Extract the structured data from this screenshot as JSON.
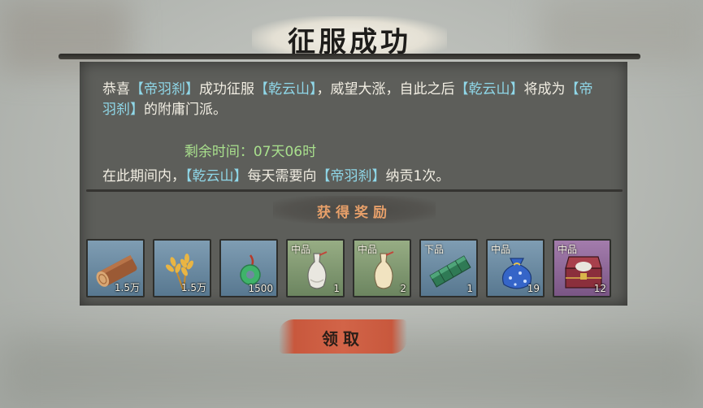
{
  "banner": {
    "title": "征服成功"
  },
  "message": {
    "t1": "恭喜",
    "sect_a": "【帝羽刹】",
    "t2": "成功征服",
    "sect_b": "【乾云山】",
    "t3": "，威望大涨，自此之后",
    "sect_b2": "【乾云山】",
    "t4": "将成为",
    "sect_a2": "【帝羽刹】",
    "t5": "的附庸门派。"
  },
  "remaining": {
    "label": "剩余时间：",
    "value": "07天06时"
  },
  "tribute": {
    "t1": "在此期间内，",
    "sect_b": "【乾云山】",
    "t2": "每天需要向",
    "sect_a": "【帝羽刹】",
    "t3": "纳贡1次。"
  },
  "rewards": {
    "header": "获得奖励",
    "items": [
      {
        "icon": "wood-log-icon",
        "grade": "",
        "qty": "1.5万",
        "color": "blue"
      },
      {
        "icon": "wheat-icon",
        "grade": "",
        "qty": "1.5万",
        "color": "blue"
      },
      {
        "icon": "jade-coin-icon",
        "grade": "",
        "qty": "1500",
        "color": "blue"
      },
      {
        "icon": "white-vase-icon",
        "grade": "中品",
        "qty": "1",
        "color": "green"
      },
      {
        "icon": "cream-vase-icon",
        "grade": "中品",
        "qty": "2",
        "color": "green"
      },
      {
        "icon": "jade-brick-icon",
        "grade": "下品",
        "qty": "1",
        "color": "blue"
      },
      {
        "icon": "blue-pouch-icon",
        "grade": "中品",
        "qty": "19",
        "color": "blue"
      },
      {
        "icon": "treasure-chest-icon",
        "grade": "中品",
        "qty": "12",
        "color": "purple"
      }
    ]
  },
  "claim_button": {
    "label": "领取"
  },
  "colors": {
    "highlight": "#8fd7e8",
    "time": "#a9e08d",
    "reward_header": "#e7a06a",
    "button": "#d26448"
  }
}
